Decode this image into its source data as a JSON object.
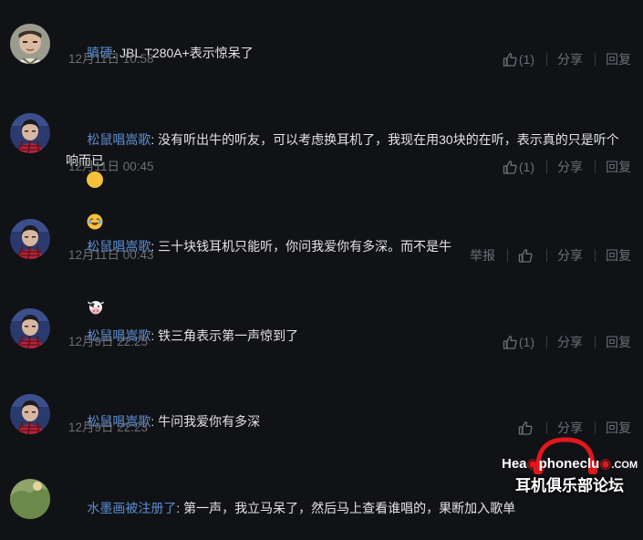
{
  "comments": [
    {
      "username": "瞋硬",
      "separator": ": ",
      "text": "JBL T280A+表示惊呆了",
      "timestamp": "12月11日 10:58",
      "likes": "(1)",
      "actions": [
        "分享",
        "回复"
      ],
      "avatar_icon": "avatar-boy-icon"
    },
    {
      "username": "松鼠唱嵩歌",
      "separator": ": ",
      "text": "没有听出牛的听友，可以考虑换耳机了，我现在用30块的在听，表示真的只是听个响而已",
      "emoji": "laugh-emoji-icon",
      "timestamp": "12月11日 00:45",
      "likes": "(1)",
      "actions": [
        "分享",
        "回复"
      ],
      "avatar_icon": "avatar-plaid-icon"
    },
    {
      "username": "松鼠唱嵩歌",
      "separator": ": ",
      "text": "三十块钱耳机只能听，你问我爱你有多深。而不是牛",
      "emoji": "cow-emoji-icon",
      "timestamp": "12月11日 00:43",
      "report": "举报",
      "actions": [
        "分享",
        "回复"
      ],
      "avatar_icon": "avatar-plaid-icon"
    },
    {
      "username": "松鼠唱嵩歌",
      "separator": ": ",
      "text": "铁三角表示第一声惊到了",
      "timestamp": "12月9日 22:25",
      "likes": "(1)",
      "actions": [
        "分享",
        "回复"
      ],
      "avatar_icon": "avatar-plaid-icon"
    },
    {
      "username": "松鼠唱嵩歌",
      "separator": ": ",
      "text": "牛问我爱你有多深",
      "timestamp": "12月9日 22:23",
      "actions": [
        "分享",
        "回复"
      ],
      "avatar_icon": "avatar-plaid-icon"
    },
    {
      "username": "水墨画被注册了",
      "separator": ": ",
      "text": "第一声，我立马呆了，然后马上查看谁唱的，果断加入歌单",
      "avatar_icon": "avatar-landscape-icon"
    }
  ],
  "watermark": {
    "logo_prefix": "Hea",
    "logo_suffix": "phoneclu",
    "logo_tail": ".COM",
    "logo_cn": "耳机俱乐部论坛"
  },
  "colors": {
    "background": "#111216",
    "username": "#5b8ed3",
    "text": "#e3e3e6",
    "meta": "#6d6f76",
    "watermark_red": "#e0171d"
  }
}
